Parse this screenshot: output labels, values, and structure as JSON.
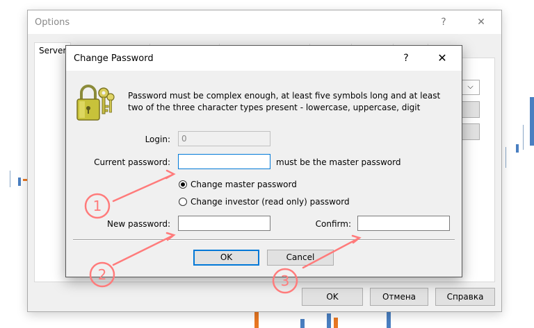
{
  "options_window": {
    "title": "Options",
    "help_glyph": "?",
    "close_glyph": "✕",
    "tab_label": "Server",
    "ok_label": "OK",
    "cancel_label": "Отмена",
    "help_label": "Справка"
  },
  "change_password": {
    "title": "Change Password",
    "help_glyph": "?",
    "close_glyph": "✕",
    "info_text": "Password must be complex enough, at least five symbols long and at least two of the three character types present - lowercase, uppercase, digit",
    "login_label": "Login:",
    "login_value": "0",
    "current_password_label": "Current password:",
    "current_password_value": "",
    "current_password_hint": "must be the master password",
    "radio_master_label": "Change master password",
    "radio_investor_label": "Change investor (read only) password",
    "selected_radio": "master",
    "new_password_label": "New password:",
    "new_password_value": "",
    "confirm_label": "Confirm:",
    "confirm_value": "",
    "ok_label": "OK",
    "cancel_label": "Cancel"
  },
  "annotations": {
    "markers": [
      "1",
      "2",
      "3"
    ],
    "color": "#ff7b7b"
  }
}
